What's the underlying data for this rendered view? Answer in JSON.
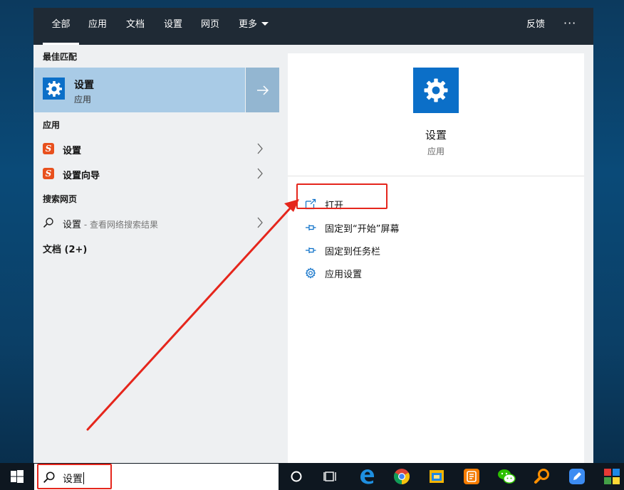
{
  "nav": {
    "tabs": [
      "全部",
      "应用",
      "文档",
      "设置",
      "网页",
      "更多"
    ],
    "feedback": "反馈",
    "more_dots": "···"
  },
  "left": {
    "best_match_title": "最佳匹配",
    "best_match": {
      "name": "设置",
      "type": "应用"
    },
    "apps_title": "应用",
    "apps": [
      "设置",
      "设置向导"
    ],
    "web_title": "搜索网页",
    "web_item": {
      "term": "设置",
      "suffix": " - 查看网络搜索结果"
    },
    "docs_title": "文档 (2+)"
  },
  "right": {
    "name": "设置",
    "type": "应用",
    "actions": [
      "打开",
      "固定到“开始”屏幕",
      "固定到任务栏",
      "应用设置"
    ]
  },
  "taskbar": {
    "search_value": "设置",
    "icons": [
      "cortana-icon",
      "task-view-icon",
      "edge-icon",
      "chrome-icon",
      "file-explorer-icon",
      "sogou-icon",
      "wechat-icon",
      "search-tool-icon",
      "feishu-icon",
      "colorful-app-icon"
    ]
  },
  "colors": {
    "accent_blue": "#0b6fc8",
    "highlight": "#a9cbe6",
    "annotation_red": "#e5261c"
  }
}
